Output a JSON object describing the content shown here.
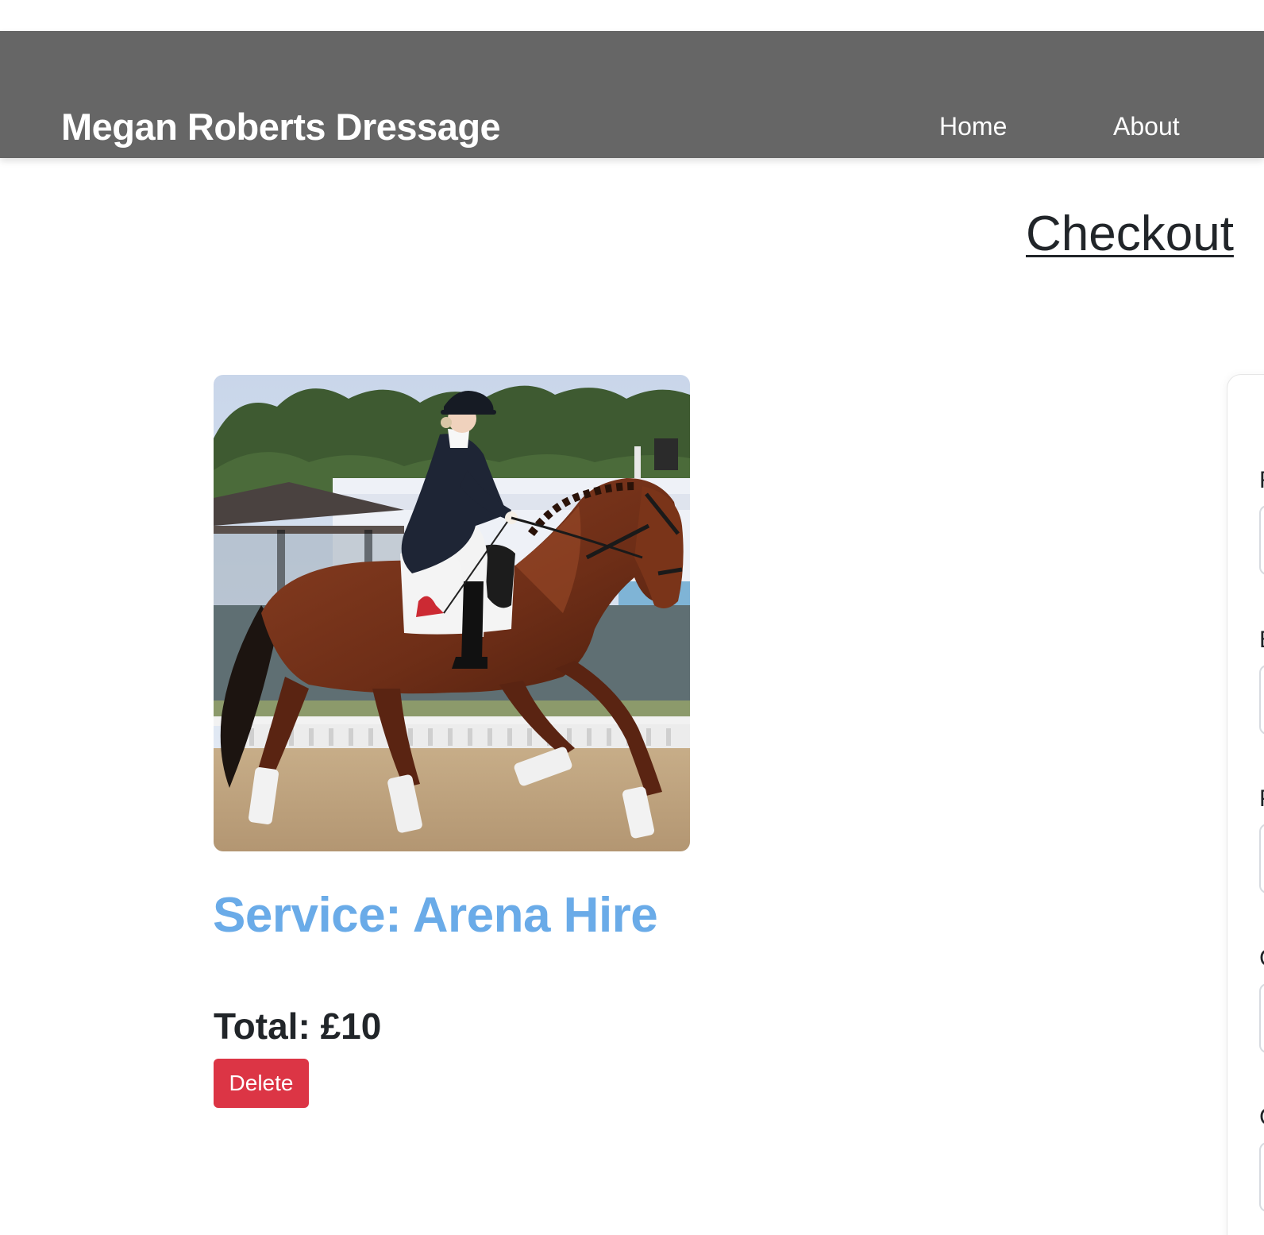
{
  "navbar": {
    "brand": "Megan Roberts Dressage",
    "links": [
      {
        "label": "Home"
      },
      {
        "label": "About"
      }
    ]
  },
  "page": {
    "title": "Checkout"
  },
  "cart_item": {
    "image_icon": "horse-dressage-photo",
    "service_title": "Service: Arena Hire",
    "total": "Total: £10",
    "delete_label": "Delete"
  },
  "checkout_form": {
    "fields": [
      {
        "label": "F",
        "value": ""
      },
      {
        "label": "E",
        "value": ""
      },
      {
        "label": "P",
        "value": ""
      },
      {
        "label": "C",
        "value": ""
      },
      {
        "label": "C",
        "value": ""
      }
    ]
  },
  "colors": {
    "navbar_bg": "#666666",
    "service_title": "#6aabe8",
    "delete_button": "#dc3545"
  }
}
